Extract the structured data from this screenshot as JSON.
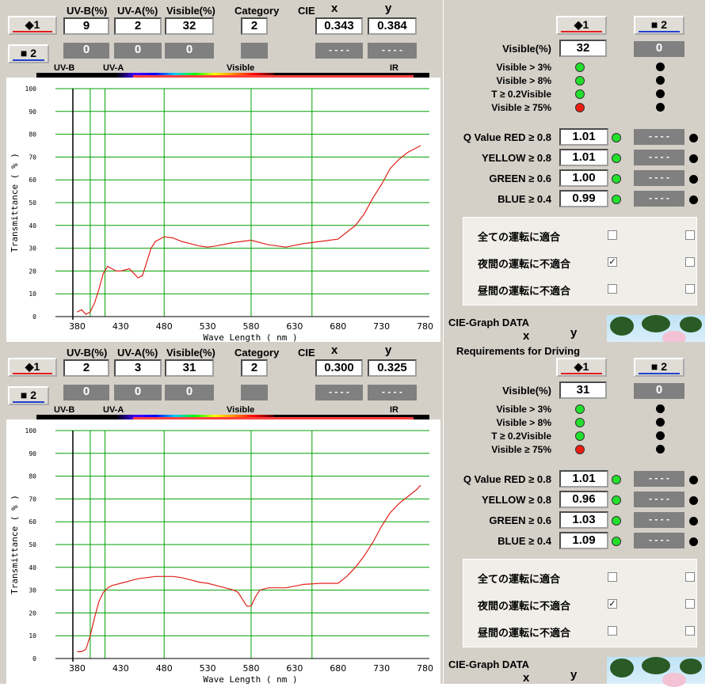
{
  "colors": {
    "red_curve": "#e0201a",
    "grid": "#00a000",
    "panel_bg": "#d4d0c8",
    "ok": "#22e02c",
    "fail": "#ee1c10"
  },
  "header_labels": {
    "uvb": "UV-B(%)",
    "uva": "UV-A(%)",
    "visible": "Visible(%)",
    "category": "Category",
    "cie": "CIE",
    "x": "x",
    "y": "y"
  },
  "sample1_label": "◆1",
  "sample2_label": "■ 2",
  "spectrum": {
    "uvb": "UV-B",
    "uva": "UV-A",
    "visible": "Visible",
    "ir": "IR"
  },
  "req_title": "Requirements for Driving",
  "visible_pct_label": "Visible(%)",
  "checks": [
    "Visible > 3%",
    "Visible > 8%",
    "T ≥ 0.2Visible",
    "Visible ≥ 75%"
  ],
  "q": {
    "red": "Q Value  RED ≥ 0.8",
    "yellow": "YELLOW ≥ 0.8",
    "green": "GREEN ≥ 0.6",
    "blue": "BLUE ≥ 0.4"
  },
  "placeholder": "- - - -",
  "disabled_value": "0",
  "japanese": [
    "全ての運転に適合",
    "夜間の運転に不適合",
    "昼間の運転に不適合"
  ],
  "cie_graph": "CIE-Graph DATA",
  "check_mark": "✓",
  "panels": [
    {
      "uvb": "9",
      "uva": "2",
      "visible": "32",
      "category": "2",
      "cie_x": "0.343",
      "cie_y": "0.384",
      "visible2": "32",
      "checks_ok": [
        true,
        true,
        true,
        false
      ],
      "q_values": [
        "1.01",
        "1.01",
        "1.00",
        "0.99"
      ],
      "driving": [
        false,
        true,
        false
      ],
      "chart_data": {
        "type": "line",
        "xlabel": "Wave Length ( nm )",
        "ylabel": "Transmittance ( % )",
        "ylim": [
          0,
          100
        ],
        "xlim": [
          355,
          785
        ],
        "xticks": [
          380,
          430,
          480,
          530,
          580,
          630,
          680,
          730,
          780
        ],
        "yticks": [
          0,
          10,
          20,
          30,
          40,
          50,
          60,
          70,
          80,
          90,
          100
        ],
        "x": [
          380,
          385,
          390,
          395,
          400,
          405,
          410,
          415,
          420,
          425,
          430,
          435,
          440,
          445,
          450,
          455,
          460,
          465,
          470,
          475,
          480,
          490,
          500,
          510,
          520,
          530,
          540,
          560,
          580,
          600,
          620,
          640,
          660,
          680,
          690,
          700,
          710,
          720,
          730,
          740,
          750,
          760,
          770,
          775
        ],
        "y": [
          2,
          3,
          1,
          2,
          6,
          12,
          19,
          22,
          21,
          20,
          20,
          20.5,
          21,
          19,
          17,
          18,
          24,
          30,
          33,
          34,
          35,
          34.5,
          33,
          32,
          31,
          30.5,
          31,
          32.5,
          33.5,
          31.5,
          30.5,
          32,
          33,
          34,
          37,
          40,
          45,
          52,
          58,
          65,
          69,
          72,
          74,
          75
        ]
      }
    },
    {
      "uvb": "2",
      "uva": "3",
      "visible": "31",
      "category": "2",
      "cie_x": "0.300",
      "cie_y": "0.325",
      "visible2": "31",
      "checks_ok": [
        true,
        true,
        true,
        false
      ],
      "q_values": [
        "1.01",
        "0.96",
        "1.03",
        "1.09"
      ],
      "driving": [
        false,
        true,
        false
      ],
      "chart_data": {
        "type": "line",
        "xlabel": "Wave Length ( nm )",
        "ylabel": "Transmittance ( % )",
        "ylim": [
          0,
          100
        ],
        "xlim": [
          355,
          785
        ],
        "xticks": [
          380,
          430,
          480,
          530,
          580,
          630,
          680,
          730,
          780
        ],
        "yticks": [
          0,
          10,
          20,
          30,
          40,
          50,
          60,
          70,
          80,
          90,
          100
        ],
        "x": [
          380,
          385,
          390,
          395,
          400,
          405,
          410,
          415,
          420,
          430,
          440,
          450,
          460,
          470,
          480,
          490,
          500,
          510,
          520,
          530,
          540,
          550,
          560,
          565,
          570,
          575,
          580,
          585,
          590,
          600,
          610,
          620,
          640,
          660,
          680,
          690,
          700,
          710,
          720,
          730,
          740,
          750,
          760,
          770,
          775
        ],
        "y": [
          3,
          3,
          4,
          10,
          18,
          25,
          29,
          31,
          32,
          33,
          34,
          35,
          35.5,
          36,
          36,
          36,
          35.5,
          34.5,
          33.5,
          33,
          32,
          31,
          30,
          29,
          26,
          23,
          23,
          27,
          30,
          31,
          31,
          31,
          32.5,
          33,
          33,
          36,
          40,
          45,
          51,
          58,
          64,
          68,
          71,
          74,
          76
        ]
      }
    }
  ]
}
